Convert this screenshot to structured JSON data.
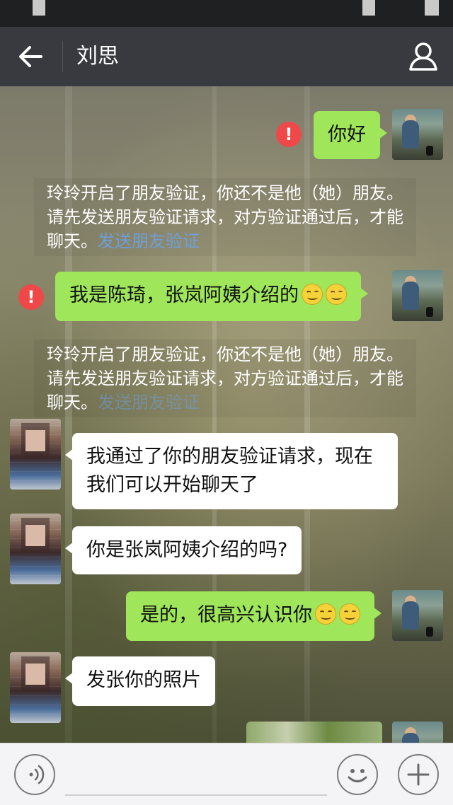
{
  "header": {
    "title": "刘思",
    "back_icon": "back-arrow-icon",
    "profile_icon": "person-icon"
  },
  "chat": {
    "timestamp": "",
    "messages": [
      {
        "side": "right",
        "text": "你好",
        "status": "failed"
      },
      {
        "type": "system",
        "text": "玲玲开启了朋友验证，你还不是他（她）朋友。请先发送朋友验证请求，对方验证通过后，才能聊天。",
        "link": "发送朋友验证"
      },
      {
        "side": "right",
        "text": "我是陈琦，张岚阿姨介绍的",
        "emoji_count": 2,
        "status": "failed"
      },
      {
        "type": "system",
        "text": "玲玲开启了朋友验证，你还不是他（她）朋友。请先发送朋友验证请求，对方验证通过后，才能聊天。",
        "link": "发送朋友验证"
      },
      {
        "side": "left",
        "text": "我通过了你的朋友验证请求，现在我们可以开始聊天了"
      },
      {
        "side": "left",
        "text": "你是张岚阿姨介绍的吗?"
      },
      {
        "side": "right",
        "text": "是的，很高兴认识你",
        "emoji_count": 2
      },
      {
        "side": "left",
        "text": "发张你的照片"
      },
      {
        "side": "right",
        "type": "image"
      }
    ]
  },
  "input": {
    "voice_icon": "voice-icon",
    "emoji_icon": "smiley-icon",
    "plus_icon": "plus-icon",
    "value": ""
  },
  "colors": {
    "titlebar": "#393a3f",
    "bubble_green": "#9fe65a",
    "error": "#f04848",
    "link": "#6e9fd9"
  }
}
